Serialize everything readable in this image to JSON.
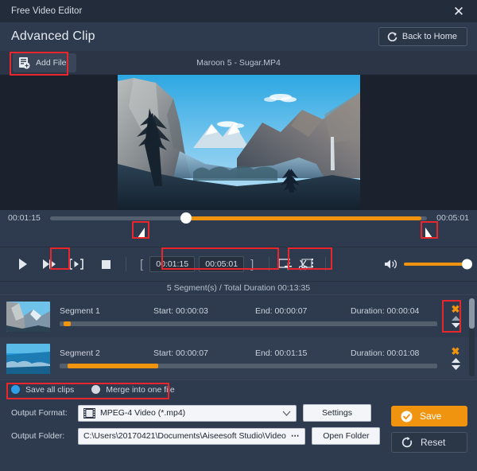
{
  "window": {
    "title": "Free Video Editor",
    "close_icon": "close-icon"
  },
  "header": {
    "page_title": "Advanced Clip",
    "back_home_label": "Back to Home",
    "back_home_icon": "redo-arrow-icon"
  },
  "toolbar": {
    "add_file_label": "Add File",
    "add_file_icon": "add-file-icon",
    "filename": "Maroon 5 - Sugar.MP4"
  },
  "preview": {
    "image_alt": "yosemite-valley-landscape"
  },
  "timeline": {
    "start_time": "00:01:15",
    "end_time": "00:05:01",
    "playhead_percent": 36,
    "fill_start_percent": 36,
    "fill_end_percent": 98.5,
    "left_handle_icon": "trim-start-handle-icon",
    "right_handle_icon": "trim-end-handle-icon"
  },
  "controls": {
    "play_icon": "play-icon",
    "fast_forward_icon": "fast-forward-icon",
    "set_marker_icon": "set-clip-marker-icon",
    "stop_icon": "stop-icon",
    "bracket_open": "[",
    "bracket_close": "]",
    "clip_start_value": "00:01:15",
    "clip_end_value": "00:05:01",
    "add_segment_icon": "add-segment-icon",
    "split_icon": "split-scissors-icon",
    "volume_icon": "volume-icon",
    "volume_percent": 100
  },
  "segments": {
    "summary": "5 Segment(s) / Total Duration 00:13:35",
    "columns": {
      "start_prefix": "Start:",
      "end_prefix": "End:",
      "duration_prefix": "Duration:"
    },
    "rows": [
      {
        "name": "Segment 1",
        "start": "Start:  00:00:03",
        "end": "End:  00:00:07",
        "duration": "Duration:  00:00:04",
        "bar_offset_percent": 1,
        "bar_width_percent": 2,
        "delete_icon": "delete-x-icon",
        "up_icon": "move-up-icon",
        "down_icon": "move-down-icon"
      },
      {
        "name": "Segment 2",
        "start": "Start:  00:00:07",
        "end": "End:  00:01:15",
        "duration": "Duration:  00:01:08",
        "bar_offset_percent": 2,
        "bar_width_percent": 24,
        "delete_icon": "delete-x-icon",
        "up_icon": "move-up-icon",
        "down_icon": "move-down-icon"
      }
    ]
  },
  "save_options": {
    "save_all_label": "Save all clips",
    "merge_label": "Merge into one file",
    "selected": "save_all"
  },
  "output": {
    "format_label": "Output Format:",
    "format_value": "MPEG-4 Video (*.mp4)",
    "format_icon": "video-file-icon",
    "dropdown_icon": "chevron-down-icon",
    "settings_label": "Settings",
    "folder_label": "Output Folder:",
    "folder_value": "C:\\Users\\20170421\\Documents\\Aiseesoft Studio\\Video",
    "folder_browse_icon": "ellipsis-icon",
    "open_folder_label": "Open Folder",
    "save_label": "Save",
    "save_icon": "check-circle-icon",
    "reset_label": "Reset",
    "reset_icon": "reset-circular-arrow-icon"
  },
  "colors": {
    "accent_orange": "#f0930f",
    "annotation_red": "#e8262b",
    "radio_blue": "#2f9ee8",
    "panel_bg": "#2e3a4d",
    "titlebar_bg": "#232c3b"
  }
}
